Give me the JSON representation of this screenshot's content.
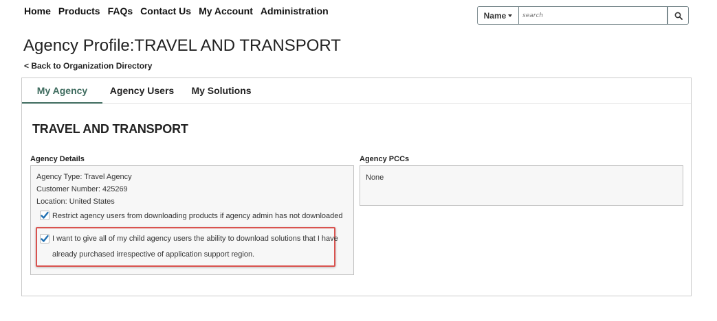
{
  "nav": {
    "items": [
      "Home",
      "Products",
      "FAQs",
      "Contact Us",
      "My Account",
      "Administration"
    ]
  },
  "search": {
    "filter_label": "Name",
    "placeholder": "search",
    "button_icon": "search-icon"
  },
  "page": {
    "title": "Agency Profile:TRAVEL AND TRANSPORT",
    "back_link": "< Back to Organization Directory"
  },
  "tabs": [
    {
      "label": "My Agency",
      "active": true
    },
    {
      "label": "Agency Users",
      "active": false
    },
    {
      "label": "My Solutions",
      "active": false
    }
  ],
  "agency": {
    "name": "TRAVEL AND TRANSPORT",
    "details_label": "Agency Details",
    "type_line": "Agency Type: Travel Agency",
    "customer_line": "Customer Number: 425269",
    "location_line": "Location: United States",
    "option1": {
      "checked": true,
      "label": "Restrict agency users from downloading products if agency admin has not downloaded"
    },
    "option2": {
      "checked": true,
      "label_line1": "I want to give all of my child agency users the ability to download solutions that I have",
      "label_line2": "already purchased irrespective of application support region."
    },
    "pccs_label": "Agency PCCs",
    "pccs_value": "None"
  },
  "colors": {
    "accent": "#3e6b5e",
    "highlight": "#d9534f",
    "check": "#1f6fb2"
  }
}
